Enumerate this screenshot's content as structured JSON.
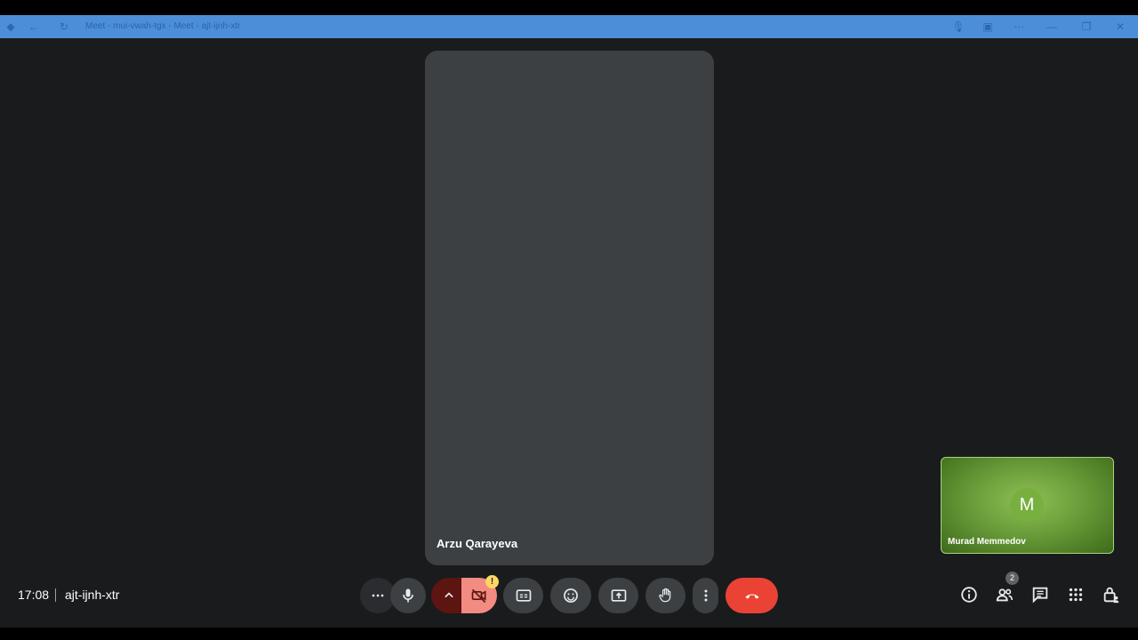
{
  "window": {
    "title": "Meet - mui-vwah-tgx - Meet - ajt-ijnh-xtr",
    "colors": {
      "titlebar": "#4c8fd8"
    }
  },
  "stage": {
    "main_participant": "Arzu Qarayeva",
    "self_participant": {
      "name": "Murad Memmedov",
      "initial": "M"
    }
  },
  "bottom_bar": {
    "time": "17:08",
    "meeting_code": "ajt-ijnh-xtr",
    "people_count": "2",
    "camera_warning": "!",
    "controls": [
      "more-options",
      "microphone",
      "camera-options",
      "camera-off",
      "captions",
      "emoji",
      "present",
      "raise-hand",
      "more",
      "leave-call"
    ],
    "side_controls": [
      "info",
      "people",
      "chat",
      "activities",
      "host-controls"
    ],
    "colors": {
      "end_call": "#ea4335",
      "camera_off": "#f28b82"
    }
  }
}
